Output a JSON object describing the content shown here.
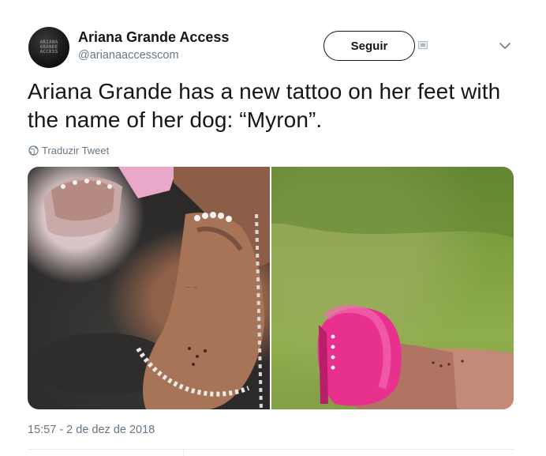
{
  "author": {
    "name": "Ariana Grande Access",
    "handle": "@arianaaccesscom",
    "avatar_text": "ARIANA\nGRANDE\nACCESS"
  },
  "follow_button": {
    "label": "Seguir"
  },
  "tweet": {
    "text": "Ariana Grande has a new tattoo on her feet with the name of her dog: “Myron”.",
    "translate_label": "Traduzir Tweet",
    "timestamp": "15:57 - 2 de dez de 2018"
  },
  "media": {
    "photos": [
      {
        "description_icon": "photo-foot-tattoo-closeup"
      },
      {
        "description_icon": "photo-pink-slipper-grass"
      }
    ]
  },
  "icons": {
    "globe": "globe-icon",
    "chevron": "chevron-down-icon",
    "follow_extra": "follow-extra-icon"
  },
  "colors": {
    "text_primary": "#14171a",
    "text_secondary": "#657786",
    "border": "#e6ecf0"
  }
}
